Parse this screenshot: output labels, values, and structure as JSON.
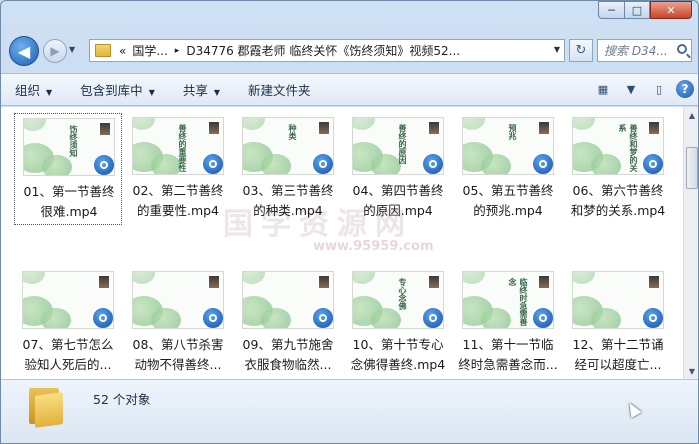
{
  "window": {
    "minimize_glyph": "─",
    "maximize_glyph": "□",
    "close_glyph": "✕"
  },
  "nav": {
    "back_glyph": "◀",
    "forward_glyph": "▶",
    "address_prefix": "«",
    "address_segments": [
      "国学...",
      "D34776 郡霞老师 临终关怀《饬终须知》视频52..."
    ],
    "address_separator": "▸",
    "refresh_glyph": "↻",
    "search_placeholder": "搜索 D34..."
  },
  "toolbar": {
    "organize": "组织",
    "include_in_library": "包含到库中",
    "share": "共享",
    "new_folder": "新建文件夹",
    "view_glyph": "▦",
    "preview_glyph": "▯",
    "help_glyph": "?"
  },
  "files": [
    {
      "line1": "01、第一节善终",
      "line2": "很难.mp4",
      "thumb_text": "饬终须知"
    },
    {
      "line1": "02、第二节善终",
      "line2": "的重要性.mp4",
      "thumb_text": "善终的重要性"
    },
    {
      "line1": "03、第三节善终",
      "line2": "的种类.mp4",
      "thumb_text": "种类"
    },
    {
      "line1": "04、第四节善终",
      "line2": "的原因.mp4",
      "thumb_text": "善终的原因"
    },
    {
      "line1": "05、第五节善终",
      "line2": "的预兆.mp4",
      "thumb_text": "预兆"
    },
    {
      "line1": "06、第六节善终",
      "line2": "和梦的关系.mp4",
      "thumb_text": "善终和梦的关系"
    },
    {
      "line1": "07、第七节怎么",
      "line2": "验知人死后的...",
      "thumb_text": ""
    },
    {
      "line1": "08、第八节杀害",
      "line2": "动物不得善终...",
      "thumb_text": ""
    },
    {
      "line1": "09、第九节施舍",
      "line2": "衣服食物临然...",
      "thumb_text": ""
    },
    {
      "line1": "10、第十节专心",
      "line2": "念佛得善终.mp4",
      "thumb_text": "专心念佛"
    },
    {
      "line1": "11、第十一节临",
      "line2": "终时急需善念而...",
      "thumb_text": "临终时急需善念"
    },
    {
      "line1": "12、第十二节诵",
      "line2": "经可以超度亡...",
      "thumb_text": ""
    }
  ],
  "watermark": {
    "main": "国学资源网",
    "url": "www.95959.com"
  },
  "scroll": {
    "up_glyph": "▲",
    "down_glyph": "▼"
  },
  "status": {
    "count": "52 个对象"
  }
}
